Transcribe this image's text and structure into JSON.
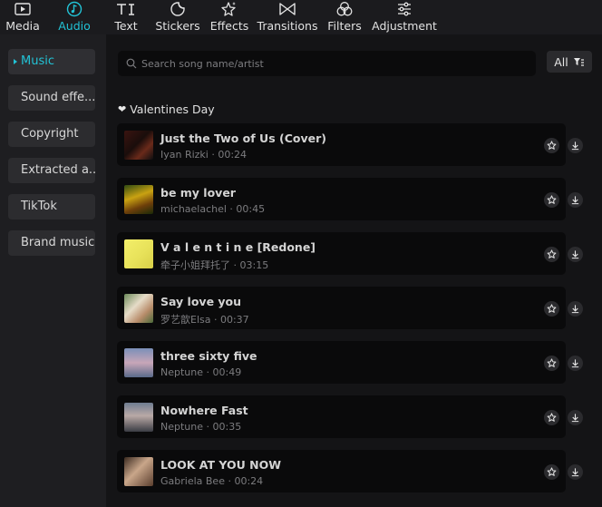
{
  "toolbar": {
    "tabs": [
      {
        "label": "Media",
        "icon": "media-icon"
      },
      {
        "label": "Audio",
        "icon": "audio-icon",
        "active": true
      },
      {
        "label": "Text",
        "icon": "text-icon"
      },
      {
        "label": "Stickers",
        "icon": "stickers-icon"
      },
      {
        "label": "Effects",
        "icon": "effects-icon"
      },
      {
        "label": "Transitions",
        "icon": "transitions-icon"
      },
      {
        "label": "Filters",
        "icon": "filters-icon"
      },
      {
        "label": "Adjustment",
        "icon": "adjustment-icon"
      }
    ]
  },
  "sidebar": {
    "items": [
      {
        "label": "Music",
        "active": true
      },
      {
        "label": "Sound effe..."
      },
      {
        "label": "Copyright"
      },
      {
        "label": "Extracted a..."
      },
      {
        "label": "TikTok"
      },
      {
        "label": "Brand music"
      }
    ]
  },
  "search": {
    "placeholder": "Search song name/artist"
  },
  "filter": {
    "label": "All"
  },
  "section": {
    "icon": "heart",
    "title": "Valentines Day"
  },
  "tracks": [
    {
      "title": "Just the Two of Us (Cover)",
      "meta": "Iyan Rizki · 00:24"
    },
    {
      "title": "be my lover",
      "meta": "michaelachel · 00:45"
    },
    {
      "title": "V a l e n t i n e  [Redone]",
      "meta": "牵子小姐拜托了 · 03:15"
    },
    {
      "title": "Say love you",
      "meta": "罗艺歆Elsa · 00:37"
    },
    {
      "title": "three sixty five",
      "meta": "Neptune · 00:49"
    },
    {
      "title": "Nowhere Fast",
      "meta": "Neptune · 00:35"
    },
    {
      "title": "LOOK AT YOU NOW",
      "meta": "Gabriela Bee · 00:24"
    }
  ],
  "colors": {
    "accent": "#22c3d6",
    "panel": "#141416",
    "card": "#0a0a0b"
  }
}
